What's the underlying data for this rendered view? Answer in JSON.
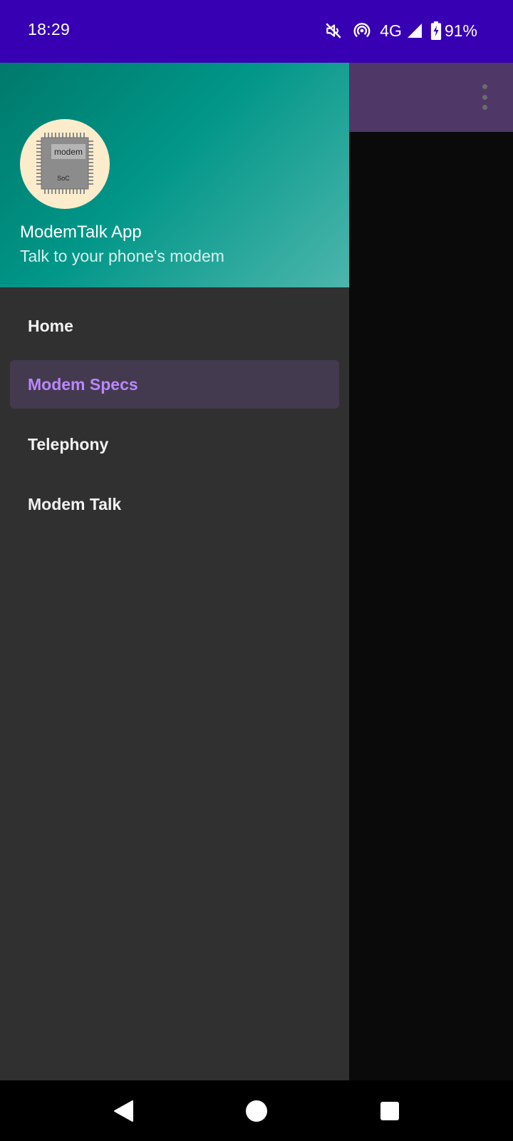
{
  "status_bar": {
    "time": "18:29",
    "network": "4G",
    "battery": "91%",
    "icons": [
      "mute-icon",
      "hotspot-icon",
      "signal-icon",
      "battery-charging-icon"
    ],
    "background": "#3700b3"
  },
  "app": {
    "toolbar_color": "#4f3867",
    "overflow_icon": "more-vert-icon"
  },
  "drawer": {
    "header": {
      "avatar_chip_label": "modem",
      "avatar_chip_sublabel": "SoC",
      "title": "ModemTalk App",
      "subtitle": "Talk to your phone's modem"
    },
    "items": [
      {
        "label": "Home",
        "active": false
      },
      {
        "label": "Modem Specs",
        "active": true
      },
      {
        "label": "Telephony",
        "active": false
      },
      {
        "label": "Modem Talk",
        "active": false
      }
    ],
    "accent_color": "#bb86fc"
  },
  "nav_bar": {
    "back": "back-icon",
    "home": "home-icon",
    "recents": "recents-icon"
  }
}
